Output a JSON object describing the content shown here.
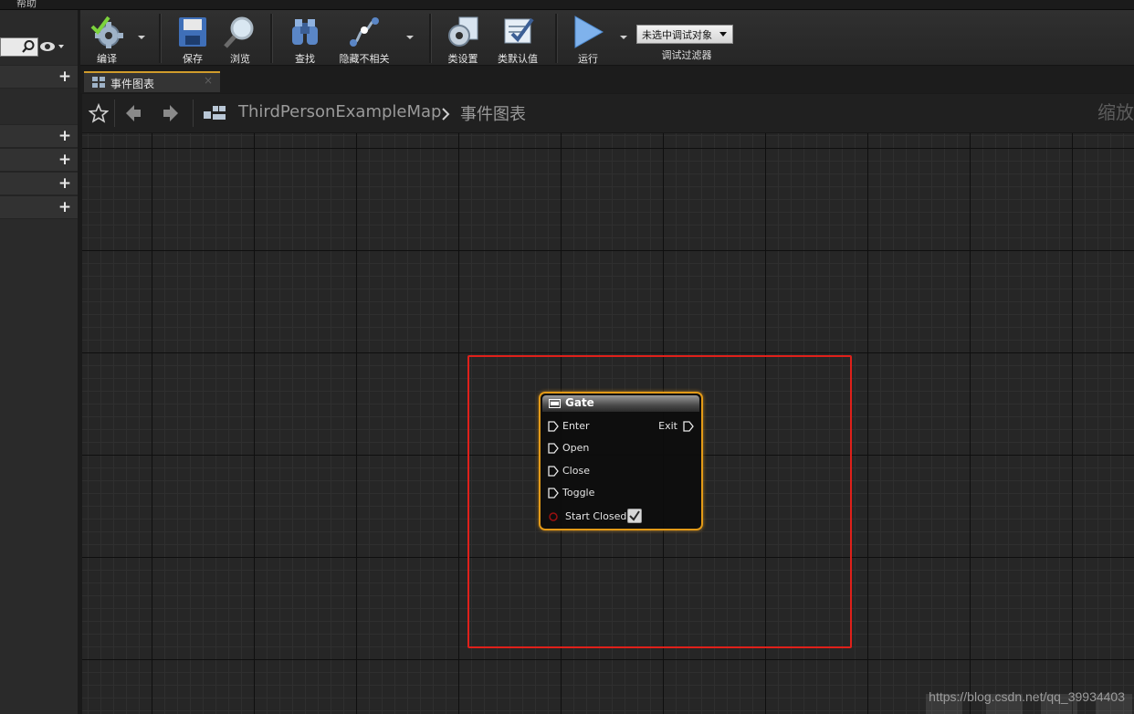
{
  "menubar": {
    "visible_item": "帮助"
  },
  "toolbar": {
    "compile": "编译",
    "save": "保存",
    "browse": "浏览",
    "find": "查找",
    "hide_unrelated": "隐藏不相关",
    "class_settings": "类设置",
    "class_defaults": "类默认值",
    "run": "运行",
    "debug_object_selected": "未选中调试对象",
    "debug_filter_label": "调试过滤器"
  },
  "tab": {
    "label": "事件图表",
    "close": "×"
  },
  "breadcrumb": {
    "map": "ThirdPersonExampleMap",
    "graph": "事件图表",
    "zoom": "缩放"
  },
  "gate_node": {
    "title": "Gate",
    "pins_in": [
      "Enter",
      "Open",
      "Close",
      "Toggle"
    ],
    "pin_out": "Exit",
    "bool_pin": "Start Closed",
    "start_closed_checked": true
  },
  "watermark": "https://blog.csdn.net/qq_39934403",
  "colors": {
    "node_border": "#e39a17",
    "highlight_box": "#e0201a",
    "tab_accent": "#d09c2c"
  }
}
